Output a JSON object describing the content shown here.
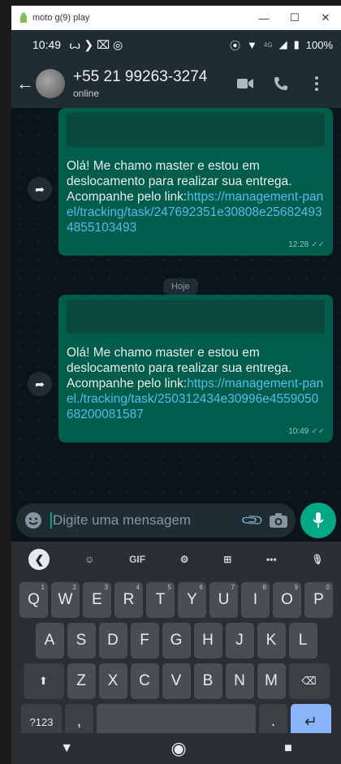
{
  "window": {
    "title": "moto g(9) play",
    "minimize": "—",
    "maximize": "☐",
    "close": "✕"
  },
  "status": {
    "time": "10:49",
    "battery": "100%",
    "network": "4G"
  },
  "header": {
    "contact_name": "+55 21 99263-3274",
    "contact_status": "online"
  },
  "messages": [
    {
      "text": "Olá! Me chamo master e estou em deslocamento para realizar sua entrega. Acompanhe pelo link:",
      "link": "https://management-panel/tracking/task/247692351e30808e256824934855103493",
      "time": "12:28"
    },
    {
      "text": "Olá! Me chamo master e estou em deslocamento para realizar sua entrega. Acompanhe pelo link:",
      "link": "https://management-panel./tracking/task/250312434e30996e455905068200081587",
      "time": "10:49"
    }
  ],
  "day_chip": "Hoje",
  "composer": {
    "placeholder": "Digite uma mensagem"
  },
  "keyboard": {
    "toolbar": [
      "GIF"
    ],
    "row1": [
      {
        "k": "Q",
        "s": "1"
      },
      {
        "k": "W",
        "s": "2"
      },
      {
        "k": "E",
        "s": "3"
      },
      {
        "k": "R",
        "s": "4"
      },
      {
        "k": "T",
        "s": "5"
      },
      {
        "k": "Y",
        "s": "6"
      },
      {
        "k": "U",
        "s": "7"
      },
      {
        "k": "I",
        "s": "8"
      },
      {
        "k": "O",
        "s": "9"
      },
      {
        "k": "P",
        "s": "0"
      }
    ],
    "row2": [
      "A",
      "S",
      "D",
      "F",
      "G",
      "H",
      "J",
      "K",
      "L"
    ],
    "row3": [
      "Z",
      "X",
      "C",
      "V",
      "B",
      "N",
      "M"
    ],
    "symbols": "?123",
    "comma": ",",
    "period": "."
  }
}
